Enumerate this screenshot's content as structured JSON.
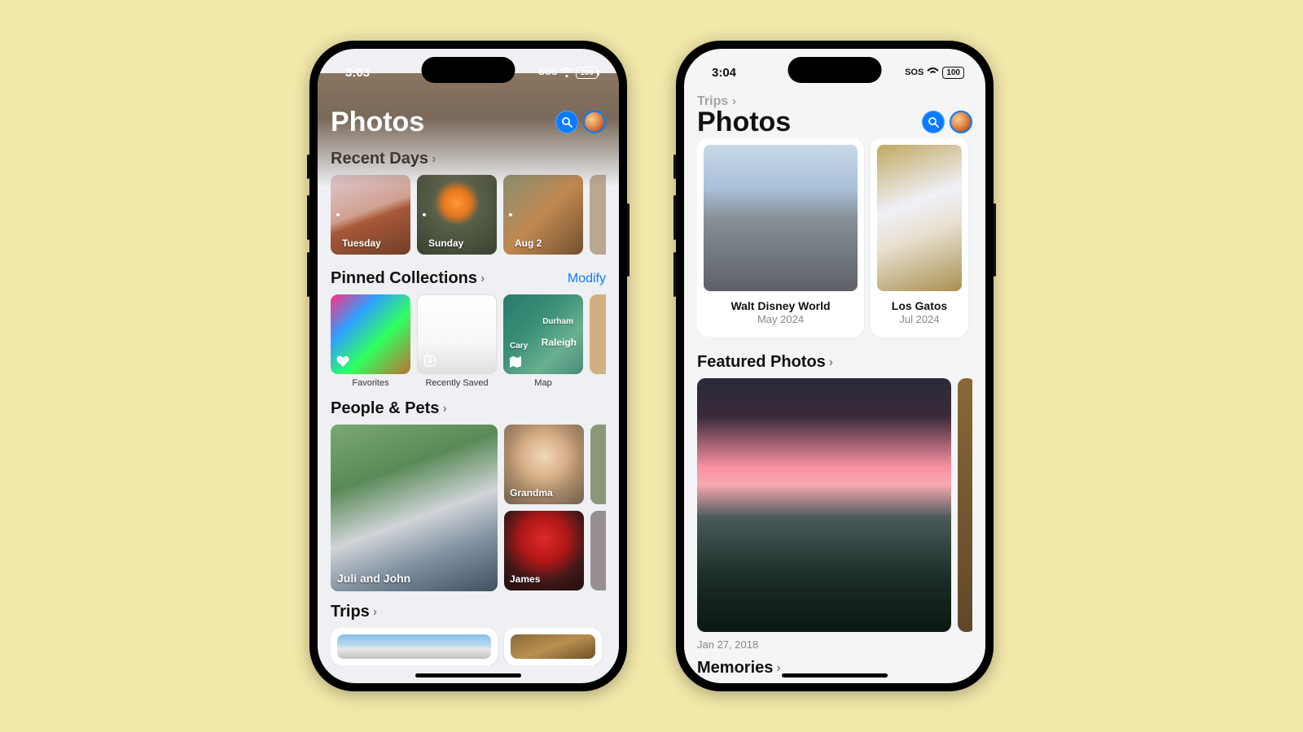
{
  "phoneA": {
    "status": {
      "time": "3:03",
      "sos": "SOS",
      "battery": "100"
    },
    "title": "Photos",
    "sections": {
      "recentDays": {
        "title": "Recent Days",
        "items": [
          {
            "label": "Tuesday"
          },
          {
            "label": "Sunday"
          },
          {
            "label": "Aug 2"
          }
        ]
      },
      "pinned": {
        "title": "Pinned Collections",
        "modify": "Modify",
        "items": [
          {
            "label": "Favorites"
          },
          {
            "label": "Recently Saved"
          },
          {
            "label": "Map",
            "city1": "Durham",
            "city2": "Raleigh",
            "city3": "Cary"
          }
        ]
      },
      "people": {
        "title": "People & Pets",
        "items": [
          {
            "label": "Juli and John"
          },
          {
            "label": "Grandma"
          },
          {
            "label": "James"
          }
        ]
      },
      "trips": {
        "title": "Trips"
      }
    }
  },
  "phoneB": {
    "status": {
      "time": "3:04",
      "sos": "SOS",
      "battery": "100"
    },
    "breadcrumb": "Trips",
    "title": "Photos",
    "trips": [
      {
        "title": "Walt Disney World",
        "sub": "May 2024"
      },
      {
        "title": "Los Gatos",
        "sub": "Jul 2024"
      }
    ],
    "featured": {
      "title": "Featured Photos",
      "items": [
        {
          "caption": "Jan 27, 2018"
        }
      ]
    },
    "memories": {
      "title": "Memories"
    }
  }
}
